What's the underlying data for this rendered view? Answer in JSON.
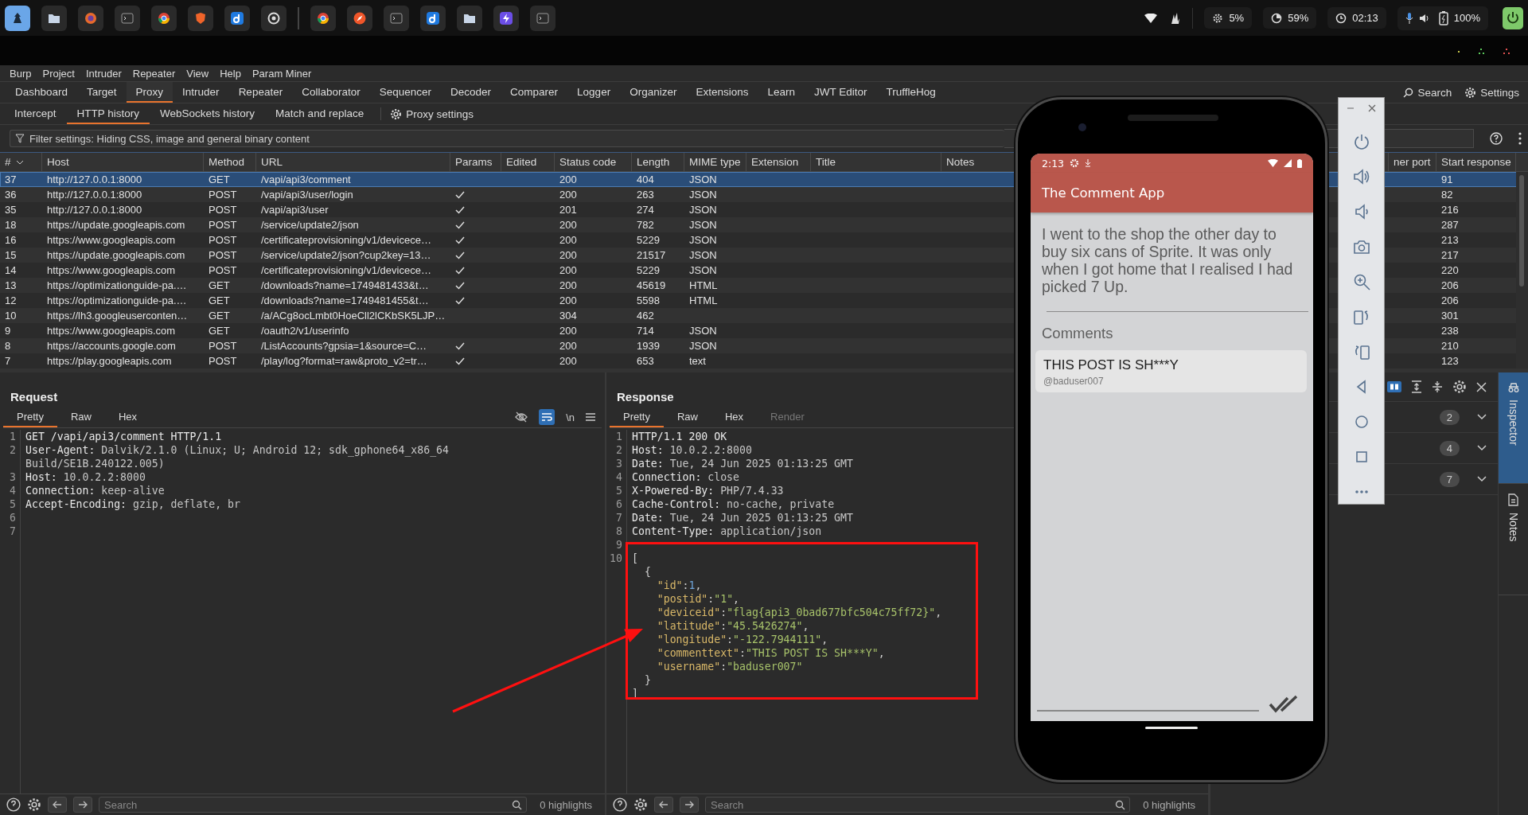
{
  "taskbar": {
    "apps": [
      {
        "kind": "launcher",
        "selected": true
      },
      {
        "kind": "folder",
        "selected": false
      },
      {
        "kind": "fox",
        "selected": false
      },
      {
        "kind": "terminal",
        "selected": false
      },
      {
        "kind": "chrome",
        "selected": false
      },
      {
        "kind": "shield",
        "selected": false
      },
      {
        "kind": "note",
        "selected": false
      },
      {
        "kind": "record",
        "selected": false
      },
      {
        "kind": "separator"
      },
      {
        "kind": "chrome",
        "selected": false
      },
      {
        "kind": "compass",
        "selected": false
      },
      {
        "kind": "terminal",
        "selected": false
      },
      {
        "kind": "note",
        "selected": false
      },
      {
        "kind": "folder",
        "selected": false
      },
      {
        "kind": "bolt",
        "selected": false
      },
      {
        "kind": "terminal",
        "selected": false
      }
    ],
    "status": [
      {
        "kind": "cpu",
        "text": "5%"
      },
      {
        "kind": "memory",
        "text": "59%"
      },
      {
        "kind": "clock",
        "text": "02:13"
      },
      {
        "kind": "battery",
        "text": "100%"
      }
    ]
  },
  "menu": [
    "Burp",
    "Project",
    "Intruder",
    "Repeater",
    "View",
    "Help",
    "Param Miner"
  ],
  "tabs": [
    {
      "label": "Dashboard",
      "selected": false
    },
    {
      "label": "Target",
      "selected": false
    },
    {
      "label": "Proxy",
      "selected": true
    },
    {
      "label": "Intruder",
      "selected": false
    },
    {
      "label": "Repeater",
      "selected": false
    },
    {
      "label": "Collaborator",
      "selected": false
    },
    {
      "label": "Sequencer",
      "selected": false
    },
    {
      "label": "Decoder",
      "selected": false
    },
    {
      "label": "Comparer",
      "selected": false
    },
    {
      "label": "Logger",
      "selected": false
    },
    {
      "label": "Organizer",
      "selected": false
    },
    {
      "label": "Extensions",
      "selected": false
    },
    {
      "label": "Learn",
      "selected": false
    },
    {
      "label": "JWT Editor",
      "selected": false
    },
    {
      "label": "TruffleHog",
      "selected": false
    }
  ],
  "top_actions": {
    "search": "Search",
    "settings": "Settings"
  },
  "subtabs": [
    {
      "label": "Intercept",
      "selected": false
    },
    {
      "label": "HTTP history",
      "selected": true
    },
    {
      "label": "WebSockets history",
      "selected": false
    },
    {
      "label": "Match and replace",
      "selected": false
    }
  ],
  "proxy_settings": "Proxy settings",
  "filter": "Filter settings: Hiding CSS, image and general binary content",
  "table": {
    "columns": [
      "#",
      "Host",
      "Method",
      "URL",
      "Params",
      "Edited",
      "Status code",
      "Length",
      "MIME type",
      "Extension",
      "Title",
      "Notes",
      "ner port",
      "Start response"
    ],
    "rows": [
      {
        "num": "37",
        "host": "http://127.0.0.1:8000",
        "method": "GET",
        "url": "/vapi/api3/comment",
        "params": false,
        "status": "200",
        "length": "404",
        "mime": "JSON",
        "start": "91",
        "selected": true
      },
      {
        "num": "36",
        "host": "http://127.0.0.1:8000",
        "method": "POST",
        "url": "/vapi/api3/user/login",
        "params": true,
        "status": "200",
        "length": "263",
        "mime": "JSON",
        "start": "82",
        "selected": false
      },
      {
        "num": "35",
        "host": "http://127.0.0.1:8000",
        "method": "POST",
        "url": "/vapi/api3/user",
        "params": true,
        "status": "201",
        "length": "274",
        "mime": "JSON",
        "start": "216",
        "selected": false
      },
      {
        "num": "18",
        "host": "https://update.googleapis.com",
        "method": "POST",
        "url": "/service/update2/json",
        "params": true,
        "status": "200",
        "length": "782",
        "mime": "JSON",
        "start": "287",
        "selected": false
      },
      {
        "num": "16",
        "host": "https://www.googleapis.com",
        "method": "POST",
        "url": "/certificateprovisioning/v1/devicece…",
        "params": true,
        "status": "200",
        "length": "5229",
        "mime": "JSON",
        "start": "213",
        "selected": false
      },
      {
        "num": "15",
        "host": "https://update.googleapis.com",
        "method": "POST",
        "url": "/service/update2/json?cup2key=13…",
        "params": true,
        "status": "200",
        "length": "21517",
        "mime": "JSON",
        "start": "217",
        "selected": false
      },
      {
        "num": "14",
        "host": "https://www.googleapis.com",
        "method": "POST",
        "url": "/certificateprovisioning/v1/devicece…",
        "params": true,
        "status": "200",
        "length": "5229",
        "mime": "JSON",
        "start": "220",
        "selected": false
      },
      {
        "num": "13",
        "host": "https://optimizationguide-pa.…",
        "method": "GET",
        "url": "/downloads?name=1749481433&t…",
        "params": true,
        "status": "200",
        "length": "45619",
        "mime": "HTML",
        "start": "206",
        "selected": false
      },
      {
        "num": "12",
        "host": "https://optimizationguide-pa.…",
        "method": "GET",
        "url": "/downloads?name=1749481455&t…",
        "params": true,
        "status": "200",
        "length": "5598",
        "mime": "HTML",
        "start": "206",
        "selected": false
      },
      {
        "num": "10",
        "host": "https://lh3.googleuserconten…",
        "method": "GET",
        "url": "/a/ACg8ocLmbt0HoeCll2lCKbSK5LJP…",
        "params": false,
        "status": "304",
        "length": "462",
        "start": "301",
        "selected": false
      },
      {
        "num": "9",
        "host": "https://www.googleapis.com",
        "method": "GET",
        "url": "/oauth2/v1/userinfo",
        "params": false,
        "status": "200",
        "length": "714",
        "mime": "JSON",
        "start": "238",
        "selected": false
      },
      {
        "num": "8",
        "host": "https://accounts.google.com",
        "method": "POST",
        "url": "/ListAccounts?gpsia=1&source=C…",
        "params": true,
        "status": "200",
        "length": "1939",
        "mime": "JSON",
        "start": "210",
        "selected": false
      },
      {
        "num": "7",
        "host": "https://play.googleapis.com",
        "method": "POST",
        "url": "/play/log?format=raw&proto_v2=tr…",
        "params": true,
        "status": "200",
        "length": "653",
        "mime": "text",
        "start": "123",
        "selected": false
      }
    ]
  },
  "request": {
    "title": "Request",
    "tabs": [
      {
        "label": "Pretty",
        "selected": true
      },
      {
        "label": "Raw",
        "selected": false
      },
      {
        "label": "Hex",
        "selected": false
      }
    ],
    "newline_label": "\\n",
    "lines": [
      {
        "n": "1",
        "tokens": [
          {
            "kind": "plain",
            "text": "GET /vapi/api3/comment HTTP/1.1"
          }
        ]
      },
      {
        "n": "2",
        "tokens": [
          {
            "kind": "name",
            "text": "User-Agent:"
          },
          {
            "kind": "value",
            "text": " Dalvik/2.1.0 (Linux; U; Android 12; sdk_gphone64_x86_64 Build/SE1B.240122.005)"
          }
        ]
      },
      {
        "n": "3",
        "tokens": [
          {
            "kind": "name",
            "text": "Host:"
          },
          {
            "kind": "value",
            "text": " 10.0.2.2:8000"
          }
        ]
      },
      {
        "n": "4",
        "tokens": [
          {
            "kind": "name",
            "text": "Connection:"
          },
          {
            "kind": "value",
            "text": " keep-alive"
          }
        ]
      },
      {
        "n": "5",
        "tokens": [
          {
            "kind": "name",
            "text": "Accept-Encoding:"
          },
          {
            "kind": "value",
            "text": " gzip, deflate, br"
          }
        ]
      },
      {
        "n": "6"
      },
      {
        "n": "7"
      }
    ],
    "footer": {
      "placeholder": "Search",
      "highlights": "0 highlights"
    }
  },
  "response": {
    "title": "Response",
    "tabs": [
      {
        "label": "Pretty",
        "selected": true,
        "disabled": false
      },
      {
        "label": "Raw",
        "selected": false,
        "disabled": false
      },
      {
        "label": "Hex",
        "selected": false,
        "disabled": false
      },
      {
        "label": "Render",
        "selected": false,
        "disabled": true
      }
    ],
    "lines": [
      {
        "n": "1",
        "tokens": [
          {
            "kind": "plain",
            "text": "HTTP/1.1 200 OK"
          }
        ]
      },
      {
        "n": "2",
        "tokens": [
          {
            "kind": "name",
            "text": "Host:"
          },
          {
            "kind": "value",
            "text": " 10.0.2.2:8000"
          }
        ]
      },
      {
        "n": "3",
        "tokens": [
          {
            "kind": "name",
            "text": "Date:"
          },
          {
            "kind": "value",
            "text": " Tue, 24 Jun 2025 01:13:25 GMT"
          }
        ]
      },
      {
        "n": "4",
        "tokens": [
          {
            "kind": "name",
            "text": "Connection:"
          },
          {
            "kind": "value",
            "text": " close"
          }
        ]
      },
      {
        "n": "5",
        "tokens": [
          {
            "kind": "name",
            "text": "X-Powered-By:"
          },
          {
            "kind": "value",
            "text": " PHP/7.4.33"
          }
        ]
      },
      {
        "n": "6",
        "tokens": [
          {
            "kind": "name",
            "text": "Cache-Control:"
          },
          {
            "kind": "value",
            "text": " no-cache, private"
          }
        ]
      },
      {
        "n": "7",
        "tokens": [
          {
            "kind": "name",
            "text": "Date:"
          },
          {
            "kind": "value",
            "text": " Tue, 24 Jun 2025 01:13:25 GMT"
          }
        ]
      },
      {
        "n": "8",
        "tokens": [
          {
            "kind": "name",
            "text": "Content-Type:"
          },
          {
            "kind": "value",
            "text": " application/json"
          }
        ]
      },
      {
        "n": "9"
      },
      {
        "n": "10",
        "tokens": [
          {
            "kind": "punct",
            "text": "["
          }
        ]
      },
      {
        "tokens": [
          {
            "kind": "punct",
            "text": "  {"
          }
        ]
      },
      {
        "tokens": [
          {
            "kind": "key",
            "text": "    \"id\""
          },
          {
            "kind": "punct",
            "text": ":"
          },
          {
            "kind": "number",
            "text": "1"
          },
          {
            "kind": "punct",
            "text": ","
          }
        ]
      },
      {
        "tokens": [
          {
            "kind": "key",
            "text": "    \"postid\""
          },
          {
            "kind": "punct",
            "text": ":"
          },
          {
            "kind": "string",
            "text": "\"1\""
          },
          {
            "kind": "punct",
            "text": ","
          }
        ]
      },
      {
        "tokens": [
          {
            "kind": "key",
            "text": "    \"deviceid\""
          },
          {
            "kind": "punct",
            "text": ":"
          },
          {
            "kind": "string",
            "text": "\"flag{api3_0bad677bfc504c75ff72}\""
          },
          {
            "kind": "punct",
            "text": ","
          }
        ]
      },
      {
        "tokens": [
          {
            "kind": "key",
            "text": "    \"latitude\""
          },
          {
            "kind": "punct",
            "text": ":"
          },
          {
            "kind": "string",
            "text": "\"45.5426274\""
          },
          {
            "kind": "punct",
            "text": ","
          }
        ]
      },
      {
        "tokens": [
          {
            "kind": "key",
            "text": "    \"longitude\""
          },
          {
            "kind": "punct",
            "text": ":"
          },
          {
            "kind": "string",
            "text": "\"-122.7944111\""
          },
          {
            "kind": "punct",
            "text": ","
          }
        ]
      },
      {
        "tokens": [
          {
            "kind": "key",
            "text": "    \"commenttext\""
          },
          {
            "kind": "punct",
            "text": ":"
          },
          {
            "kind": "string",
            "text": "\"THIS POST IS SH***Y\""
          },
          {
            "kind": "punct",
            "text": ","
          }
        ]
      },
      {
        "tokens": [
          {
            "kind": "key",
            "text": "    \"username\""
          },
          {
            "kind": "punct",
            "text": ":"
          },
          {
            "kind": "string",
            "text": "\"baduser007\""
          }
        ]
      },
      {
        "tokens": [
          {
            "kind": "punct",
            "text": "  }"
          }
        ]
      },
      {
        "tokens": [
          {
            "kind": "punct",
            "text": "]"
          }
        ]
      }
    ],
    "footer": {
      "placeholder": "Search",
      "highlights": "0 highlights"
    }
  },
  "inspector": {
    "sections": [
      {
        "count": "2",
        "expanded": false
      },
      {
        "count": "4",
        "expanded": false
      },
      {
        "count": "7",
        "expanded": false
      }
    ]
  },
  "side_tabs": [
    {
      "label": "Inspector",
      "selected": true
    },
    {
      "label": "Notes",
      "selected": false
    }
  ],
  "phone": {
    "time": "2:13",
    "app_title": "The Comment App",
    "post": "I went to the shop the other day to buy six cans of Sprite. It was only when I got home that I realised I had picked 7 Up.",
    "comments_heading": "Comments",
    "comments": [
      {
        "text": "THIS POST IS SH***Y",
        "user": "@baduser007"
      }
    ]
  },
  "emulator_controls": [
    {
      "kind": "power"
    },
    {
      "kind": "volume-up"
    },
    {
      "kind": "volume-down"
    },
    {
      "kind": "camera"
    },
    {
      "kind": "zoom"
    },
    {
      "kind": "rotate-left"
    },
    {
      "kind": "rotate-right"
    },
    {
      "kind": "back"
    },
    {
      "kind": "home"
    },
    {
      "kind": "overview"
    },
    {
      "kind": "more"
    }
  ]
}
